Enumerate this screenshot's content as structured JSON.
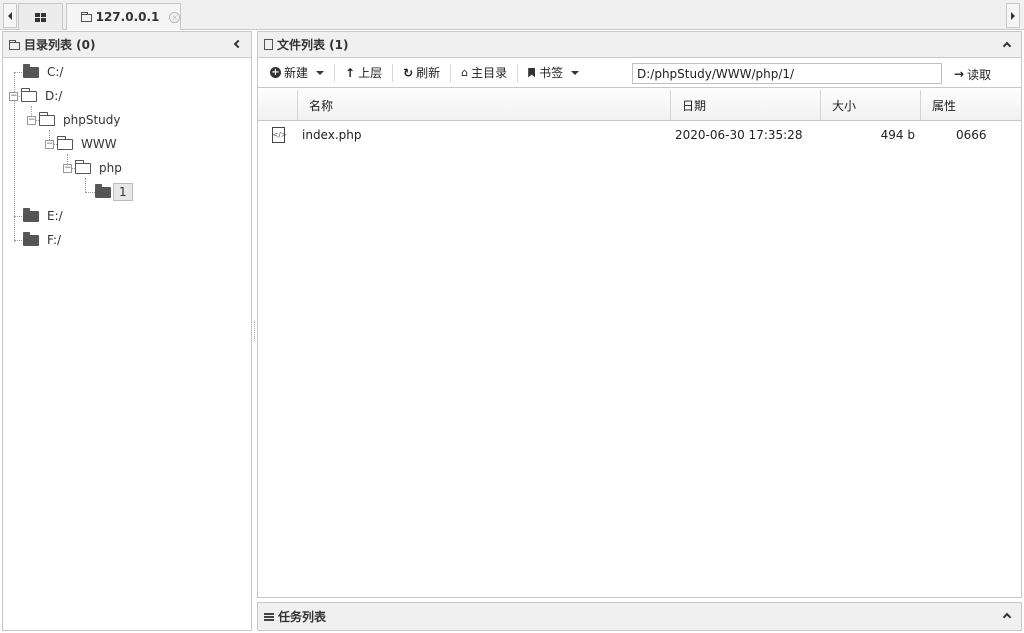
{
  "tabs": {
    "host_label": "127.0.0.1"
  },
  "left_panel": {
    "title": "目录列表 (0)",
    "tree": {
      "drive_c": "C:/",
      "drive_d": "D:/",
      "phpstudy": "phpStudy",
      "www": "WWW",
      "php": "php",
      "dir_1": "1",
      "drive_e": "E:/",
      "drive_f": "F:/"
    }
  },
  "right_panel": {
    "title": "文件列表 (1)",
    "toolbar": {
      "new_label": "新建",
      "up_label": "上层",
      "refresh_label": "刷新",
      "home_label": "主目录",
      "bookmark_label": "书签",
      "path_value": "D:/phpStudy/WWW/php/1/",
      "read_label": "读取"
    },
    "table": {
      "headers": {
        "name": "名称",
        "date": "日期",
        "size": "大小",
        "attr": "属性"
      },
      "rows": [
        {
          "name": "index.php",
          "date": "2020-06-30 17:35:28",
          "size": "494 b",
          "attr": "0666"
        }
      ]
    }
  },
  "task_panel": {
    "title": "任务列表"
  }
}
